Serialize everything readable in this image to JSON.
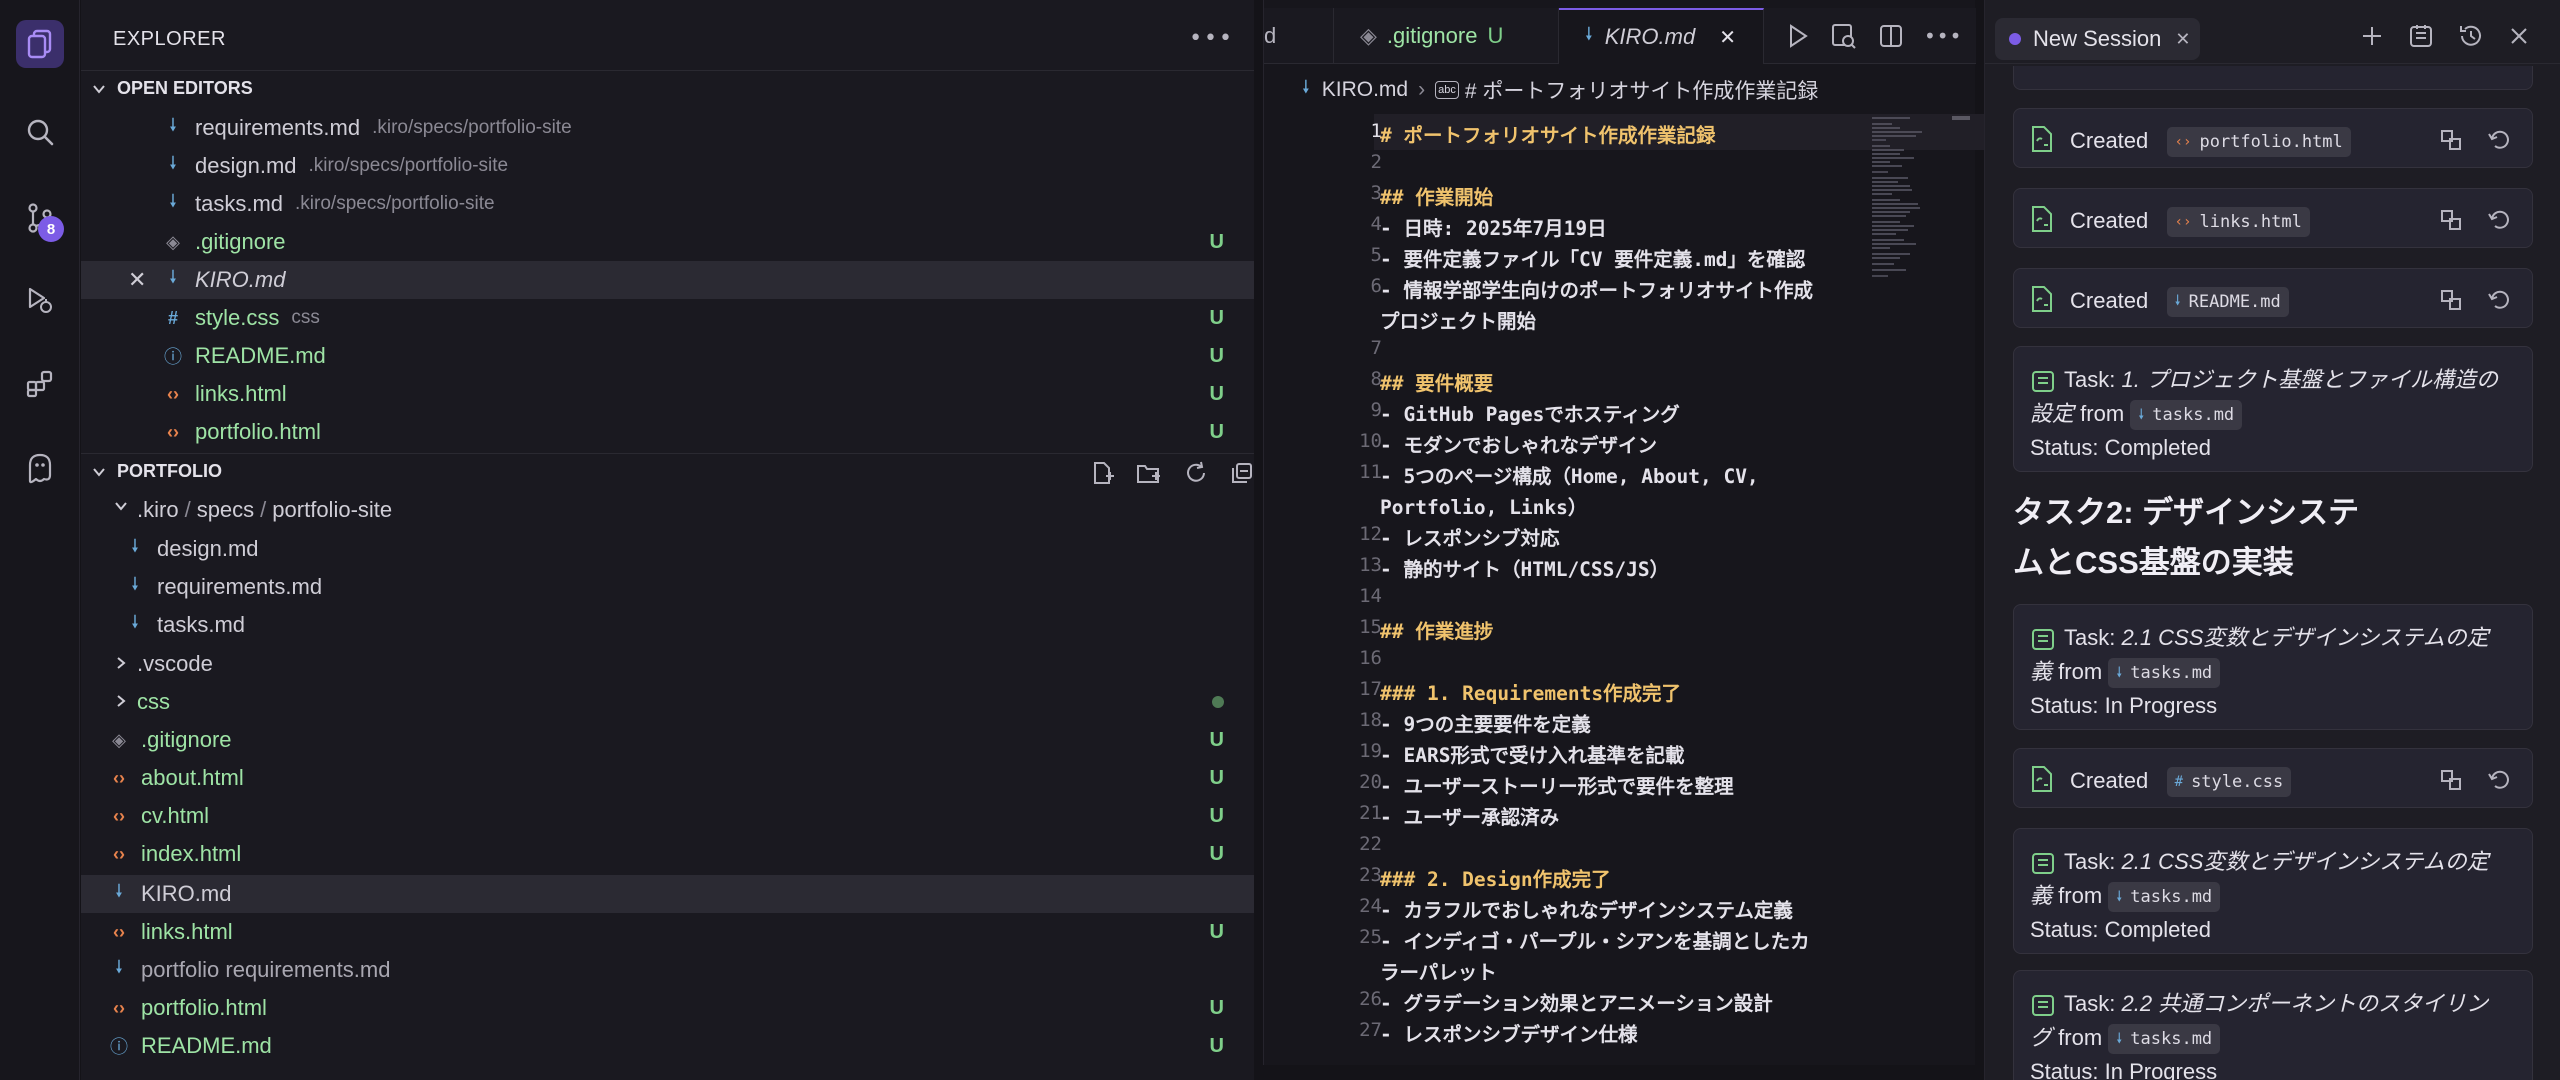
{
  "activity_bar": {
    "items": [
      "explorer-icon",
      "search-icon",
      "source-control-icon",
      "debug-icon",
      "extensions-icon",
      "kiro-ghost-icon"
    ],
    "source_control_badge": "8",
    "accent": "#7c5ce6"
  },
  "explorer": {
    "title": "EXPLORER",
    "open_editors": {
      "title": "OPEN EDITORS",
      "items": [
        {
          "name": "requirements.md",
          "path": ".kiro/specs/portfolio-site",
          "status": "",
          "icon": "markdown-icon"
        },
        {
          "name": "design.md",
          "path": ".kiro/specs/portfolio-site",
          "status": "",
          "icon": "markdown-icon"
        },
        {
          "name": "tasks.md",
          "path": ".kiro/specs/portfolio-site",
          "status": "",
          "icon": "markdown-icon"
        },
        {
          "name": ".gitignore",
          "path": "",
          "status": "U",
          "icon": "git-icon"
        },
        {
          "name": "KIRO.md",
          "path": "",
          "status": "",
          "icon": "markdown-icon"
        },
        {
          "name": "style.css",
          "path": "css",
          "status": "U",
          "icon": "css-icon"
        },
        {
          "name": "README.md",
          "path": "",
          "status": "U",
          "icon": "info-icon"
        },
        {
          "name": "links.html",
          "path": "",
          "status": "U",
          "icon": "html-icon"
        },
        {
          "name": "portfolio.html",
          "path": "",
          "status": "U",
          "icon": "html-icon"
        }
      ]
    },
    "portfolio": {
      "title": "PORTFOLIO",
      "spec_folder": {
        "a": ".kiro",
        "b": "specs",
        "c": "portfolio-site"
      },
      "spec_files": [
        "design.md",
        "requirements.md",
        "tasks.md"
      ],
      "folders": [
        ".vscode",
        "css"
      ],
      "files": [
        {
          "name": ".gitignore",
          "status": "U"
        },
        {
          "name": "about.html",
          "status": "U"
        },
        {
          "name": "cv.html",
          "status": "U"
        },
        {
          "name": "index.html",
          "status": "U"
        },
        {
          "name": "KIRO.md",
          "status": ""
        },
        {
          "name": "links.html",
          "status": "U"
        },
        {
          "name": "portfolio requirements.md",
          "status": ""
        },
        {
          "name": "portfolio.html",
          "status": "U"
        },
        {
          "name": "README.md",
          "status": "U"
        }
      ]
    }
  },
  "editor": {
    "tabs": [
      {
        "label": "d"
      },
      {
        "label": ".gitignore",
        "status": "U"
      },
      {
        "label": "KIRO.md"
      }
    ],
    "breadcrumb": {
      "file": "KIRO.md",
      "symbol": "# ポートフォリオサイト作成作業記録"
    },
    "lines": [
      {
        "n": "1",
        "t": "# ポートフォリオサイト作成作業記録"
      },
      {
        "n": "2",
        "t": ""
      },
      {
        "n": "3",
        "t": "## 作業開始"
      },
      {
        "n": "4",
        "t": "- 日時: 2025年7月19日"
      },
      {
        "n": "5",
        "t": "- 要件定義ファイル「CV 要件定義.md」を確認"
      },
      {
        "n": "6",
        "t": "- 情報学部学生向けのポートフォリオサイト作成"
      },
      {
        "n": "",
        "t": "プロジェクト開始"
      },
      {
        "n": "7",
        "t": ""
      },
      {
        "n": "8",
        "t": "## 要件概要"
      },
      {
        "n": "9",
        "t": "- GitHub Pagesでホスティング"
      },
      {
        "n": "10",
        "t": "- モダンでおしゃれなデザイン"
      },
      {
        "n": "11",
        "t": "- 5つのページ構成（Home, About, CV,"
      },
      {
        "n": "",
        "t": "Portfolio, Links）"
      },
      {
        "n": "12",
        "t": "- レスポンシブ対応"
      },
      {
        "n": "13",
        "t": "- 静的サイト（HTML/CSS/JS）"
      },
      {
        "n": "14",
        "t": ""
      },
      {
        "n": "15",
        "t": "## 作業進捗"
      },
      {
        "n": "16",
        "t": ""
      },
      {
        "n": "17",
        "t": "### 1. Requirements作成完了"
      },
      {
        "n": "18",
        "t": "- 9つの主要要件を定義"
      },
      {
        "n": "19",
        "t": "- EARS形式で受け入れ基準を記載"
      },
      {
        "n": "20",
        "t": "- ユーザーストーリー形式で要件を整理"
      },
      {
        "n": "21",
        "t": "- ユーザー承認済み"
      },
      {
        "n": "22",
        "t": ""
      },
      {
        "n": "23",
        "t": "### 2. Design作成完了"
      },
      {
        "n": "24",
        "t": "- カラフルでおしゃれなデザインシステム定義"
      },
      {
        "n": "25",
        "t": "- インディゴ・パープル・シアンを基調としたカ"
      },
      {
        "n": "",
        "t": "ラーパレット"
      },
      {
        "n": "26",
        "t": "- グラデーション効果とアニメーション設計"
      },
      {
        "n": "27",
        "t": "- レスポンシブデザイン仕様"
      }
    ]
  },
  "chat": {
    "session_tab": "New Session",
    "created_label": "Created",
    "created_items": [
      {
        "file": "portfolio.html",
        "kind": "html"
      },
      {
        "file": "links.html",
        "kind": "html"
      },
      {
        "file": "README.md",
        "kind": "md"
      }
    ],
    "task_label": "Task:",
    "from_label": "from",
    "status_label": "Status:",
    "task1": {
      "title": "1. プロジェクト基盤とファイル構造の設定",
      "file": "tasks.md",
      "status": "Completed"
    },
    "heading": "タスク2: デザインシステムとCSS基盤の実装",
    "task2a": {
      "title": "2.1 CSS変数とデザインシステムの定義",
      "file": "tasks.md",
      "status": "In Progress"
    },
    "created_style": {
      "file": "style.css",
      "kind": "css"
    },
    "task2b": {
      "title": "2.1 CSS変数とデザインシステムの定義",
      "file": "tasks.md",
      "status": "Completed"
    },
    "task2c": {
      "title": "2.2 共通コンポーネントのスタイリング",
      "file": "tasks.md",
      "status": "In Progress"
    }
  }
}
